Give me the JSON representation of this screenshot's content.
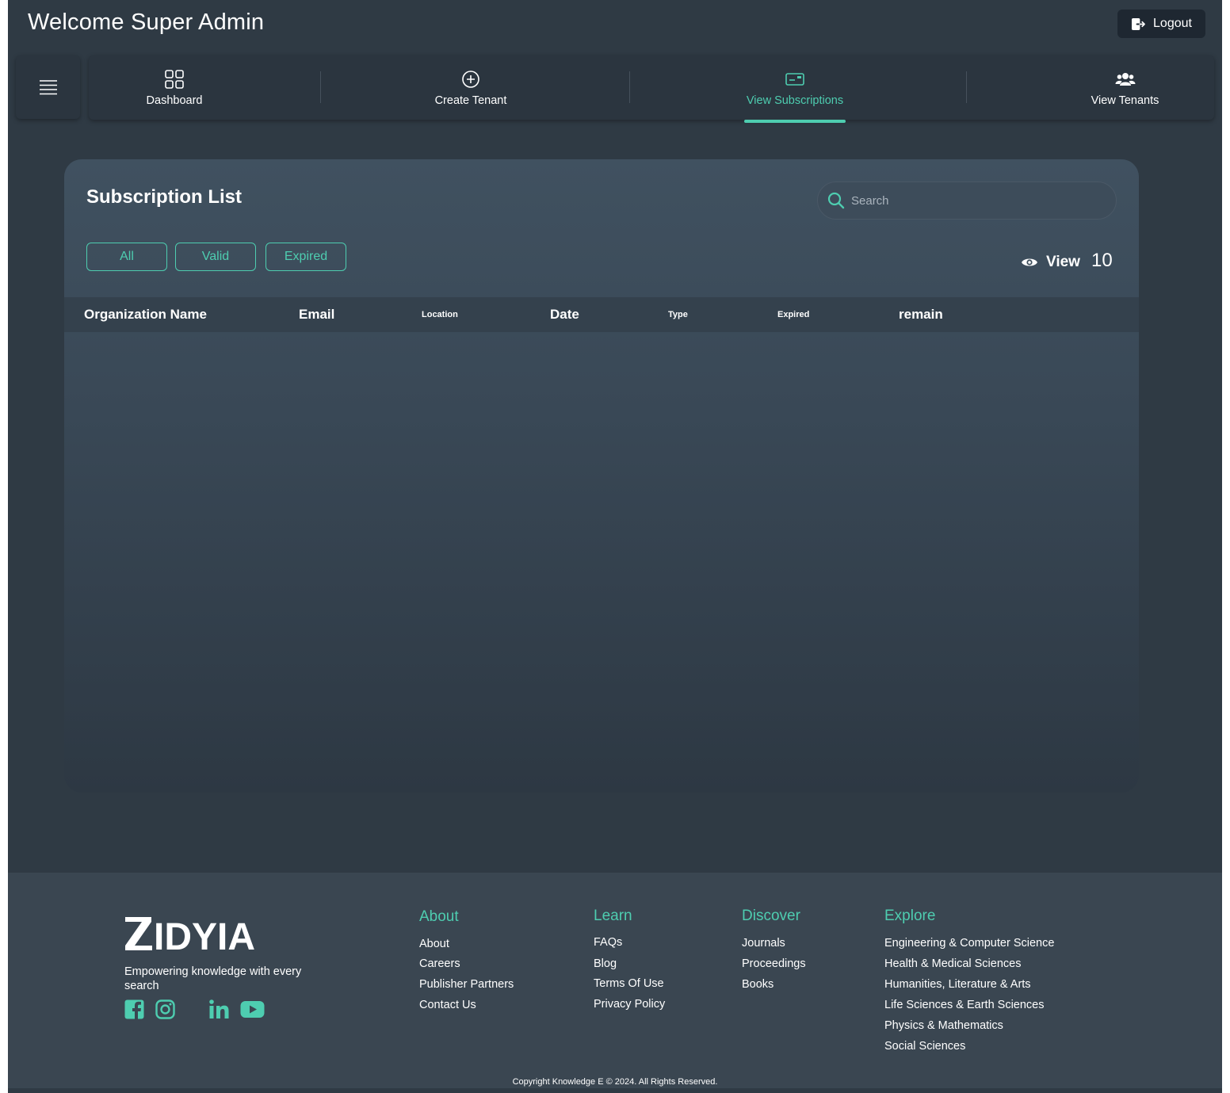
{
  "header": {
    "welcome": "Welcome Super Admin",
    "logout_label": "Logout"
  },
  "nav": {
    "items": [
      {
        "label": "Dashboard",
        "icon": "dashboard-grid-icon"
      },
      {
        "label": "Create Tenant",
        "icon": "plus-circle-icon"
      },
      {
        "label": "View Subscriptions",
        "icon": "card-icon",
        "active": true
      },
      {
        "label": "View Tenants",
        "icon": "users-icon"
      }
    ]
  },
  "card": {
    "title": "Subscription List",
    "search_placeholder": "Search",
    "filters": [
      "All",
      "Valid",
      "Expired"
    ],
    "view_label": "View",
    "view_count": "10",
    "columns": [
      "Organization Name",
      "Email",
      "Location",
      "Date",
      "Type",
      "Expired",
      "remain"
    ],
    "rows": []
  },
  "footer": {
    "brand": "ZIDYIA",
    "tagline": "Empowering knowledge with every search",
    "social": [
      "facebook-icon",
      "instagram-icon",
      "linkedin-icon",
      "youtube-icon"
    ],
    "columns": [
      {
        "heading": "About",
        "links": [
          "About",
          "Careers",
          "Publisher Partners",
          "Contact Us"
        ]
      },
      {
        "heading": "Learn",
        "links": [
          "FAQs",
          "Blog",
          "Terms Of Use",
          "Privacy Policy"
        ]
      },
      {
        "heading": "Discover",
        "links": [
          "Journals",
          "Proceedings",
          "Books"
        ]
      },
      {
        "heading": "Explore",
        "links": [
          "Engineering & Computer Science",
          "Health & Medical Sciences",
          "Humanities, Literature & Arts",
          "Life Sciences & Earth Sciences",
          "Physics & Mathematics",
          "Social Sciences"
        ]
      }
    ],
    "copyright": "Copyright Knowledge E © 2024. All Rights Reserved."
  },
  "colors": {
    "accent": "#4ecdb0",
    "background": "#2f3a44",
    "card": "#3d4c5a",
    "footer": "#3a4651"
  }
}
